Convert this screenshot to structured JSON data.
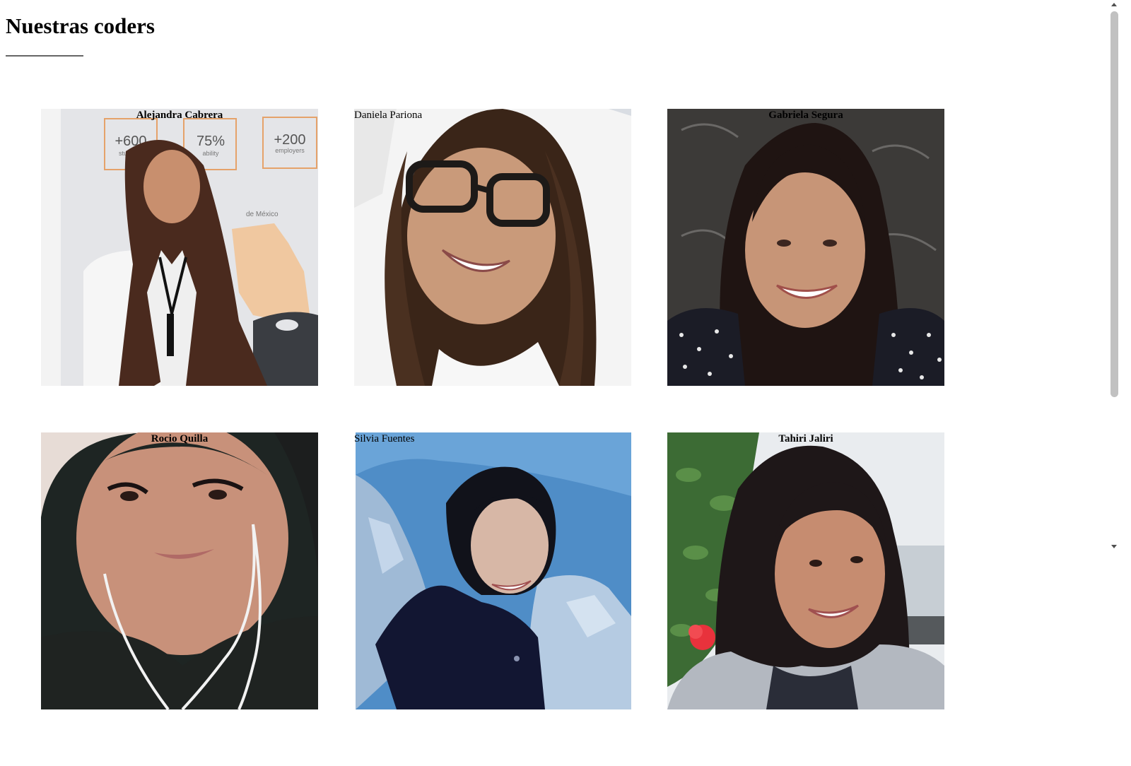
{
  "page": {
    "title": "Nuestras coders"
  },
  "coders": [
    {
      "name": "Alejandra Cabrera",
      "photo_icon": "person-photo"
    },
    {
      "name": "Daniela Pariona",
      "photo_icon": "person-photo"
    },
    {
      "name": "Gabriela Segura",
      "photo_icon": "person-photo"
    },
    {
      "name": "Rocio Quilla",
      "photo_icon": "person-photo"
    },
    {
      "name": "Silvia Fuentes",
      "photo_icon": "person-photo"
    },
    {
      "name": "Tahiri Jaliri",
      "photo_icon": "person-photo"
    }
  ],
  "photo_backgrounds": {
    "office": {
      "stat_1": "+600",
      "stat_1_label": "students",
      "stat_2": "75%",
      "stat_2_label": "ability",
      "stat_3": "+200",
      "stat_3_label": "employers",
      "map_label": "de México"
    }
  },
  "colors": {
    "background": "#ffffff",
    "text": "#000000",
    "underline": "#666666",
    "scroll_thumb": "#c1c1c1"
  }
}
